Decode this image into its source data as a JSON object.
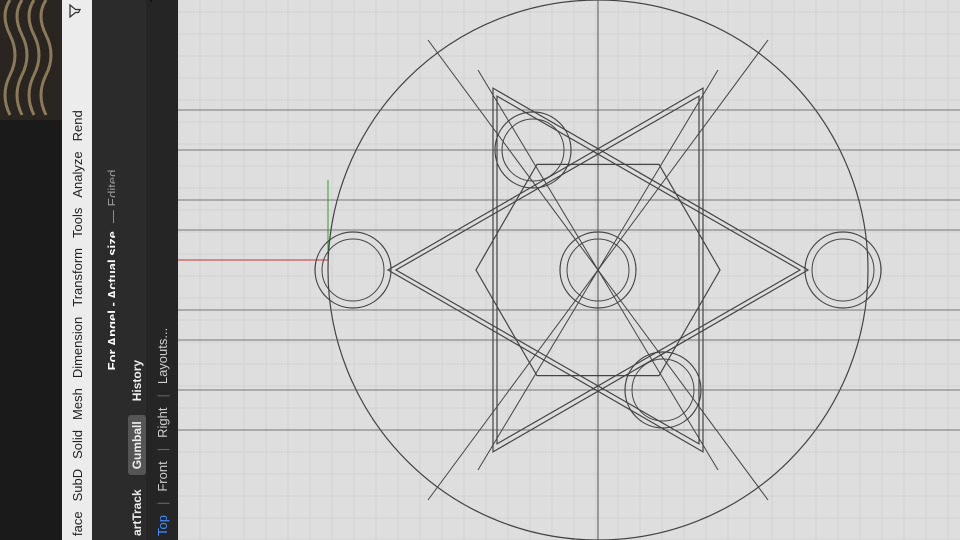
{
  "menu": {
    "items": [
      "face",
      "SubD",
      "Solid",
      "Mesh",
      "Dimension",
      "Transform",
      "Tools",
      "Analyze",
      "Rend"
    ]
  },
  "window": {
    "title": "For Angel - Actual size",
    "status": "— Edited"
  },
  "toolbar": {
    "items": [
      "artTrack",
      "Gumball",
      "History"
    ],
    "active": "Gumball"
  },
  "viewports": {
    "tabs": [
      "Top",
      "Front",
      "Right",
      "Layouts..."
    ],
    "separator": "|",
    "active": "Top"
  },
  "colors": {
    "viewport_bg": "#dedede",
    "grid": "#c8c8c8",
    "curve": "#444444",
    "active_tab": "#3f8dff",
    "axis_x": "#d03030",
    "axis_y": "#30a030"
  },
  "icons": [
    "filter-icon",
    "cursor-icon"
  ]
}
